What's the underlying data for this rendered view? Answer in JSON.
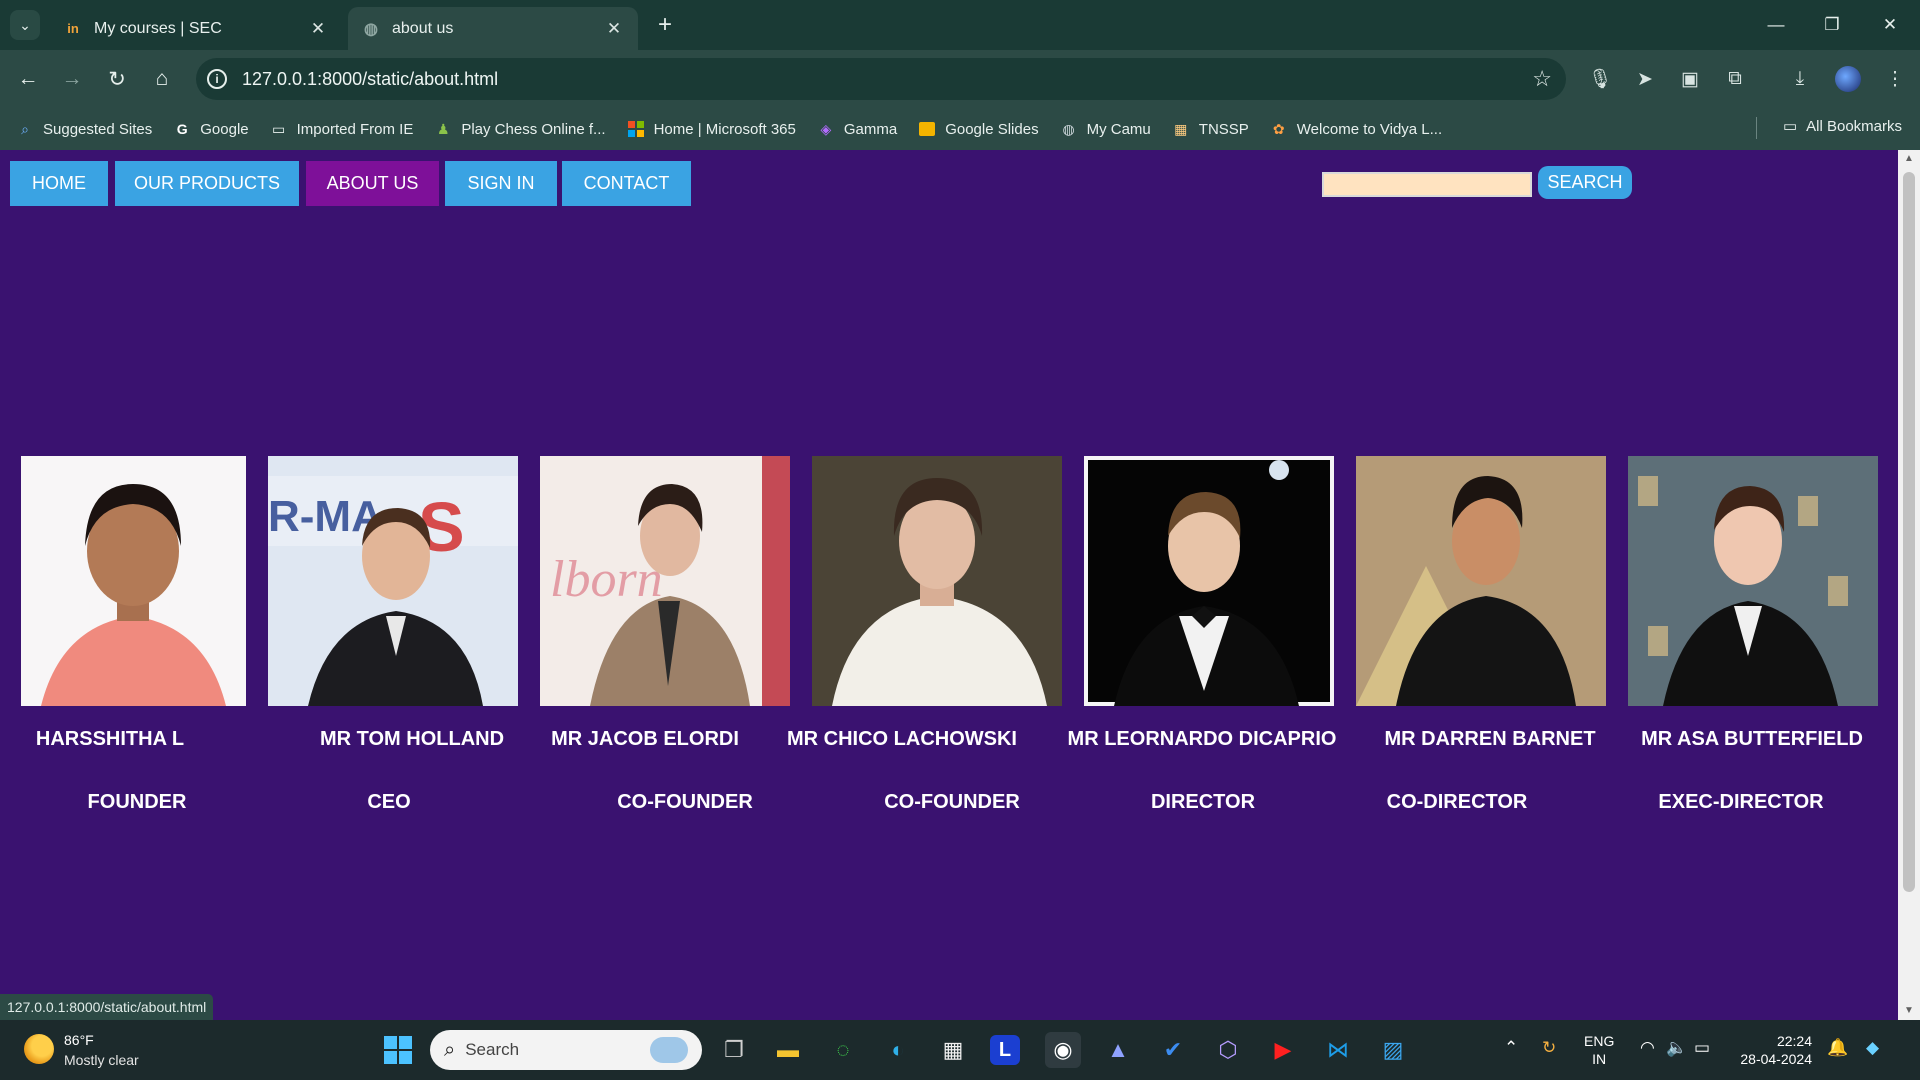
{
  "browser": {
    "tabs": [
      {
        "title": "My courses | SEC",
        "favicon": "in-icon"
      },
      {
        "title": "about us",
        "favicon": "globe-icon"
      }
    ],
    "url": "127.0.0.1:8000/static/about.html",
    "bookmarks": [
      {
        "label": "Suggested Sites",
        "icon": "suggested-icon"
      },
      {
        "label": "Google",
        "icon": "google-icon"
      },
      {
        "label": "Imported From IE",
        "icon": "folder-icon"
      },
      {
        "label": "Play Chess Online f...",
        "icon": "chess-icon"
      },
      {
        "label": "Home | Microsoft 365",
        "icon": "microsoft-icon"
      },
      {
        "label": "Gamma",
        "icon": "gamma-icon"
      },
      {
        "label": "Google Slides",
        "icon": "slides-icon"
      },
      {
        "label": "My Camu",
        "icon": "camu-icon"
      },
      {
        "label": "TNSSP",
        "icon": "tnssp-icon"
      },
      {
        "label": "Welcome to Vidya L...",
        "icon": "vidya-icon"
      }
    ],
    "all_bookmarks": "All Bookmarks",
    "status_url": "127.0.0.1:8000/static/about.html"
  },
  "page": {
    "nav": [
      {
        "label": "HOME",
        "active": false
      },
      {
        "label": "OUR PRODUCTS",
        "active": false
      },
      {
        "label": "ABOUT US",
        "active": true
      },
      {
        "label": "SIGN IN",
        "active": false
      },
      {
        "label": "CONTACT",
        "active": false
      }
    ],
    "search_button": "SEARCH",
    "search_value": "",
    "colors": {
      "background": "#3a1270",
      "nav_button": "#3aa3e3",
      "nav_active": "#7e1099",
      "search_input": "#ffe3c0"
    },
    "team": [
      {
        "name": "HARSSHITHA L",
        "role": "FOUNDER"
      },
      {
        "name": "MR TOM HOLLAND",
        "role": "CEO"
      },
      {
        "name": "MR JACOB ELORDI",
        "role": "CO-FOUNDER"
      },
      {
        "name": "MR CHICO LACHOWSKI",
        "role": "CO-FOUNDER"
      },
      {
        "name": "MR LEORNARDO DICAPRIO",
        "role": "DIRECTOR"
      },
      {
        "name": "MR DARREN BARNET",
        "role": "CO-DIRECTOR"
      },
      {
        "name": "MR ASA BUTTERFIELD",
        "role": "EXEC-DIRECTOR"
      }
    ]
  },
  "taskbar": {
    "weather_temp": "86°F",
    "weather_desc": "Mostly clear",
    "search_placeholder": "Search",
    "lang": "ENG",
    "region": "IN",
    "time": "22:24",
    "date": "28-04-2024"
  }
}
